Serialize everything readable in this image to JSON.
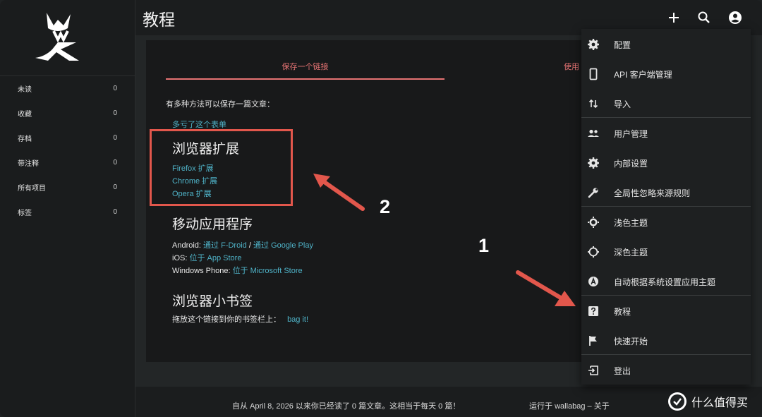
{
  "header": {
    "title": "教程",
    "icons": [
      "plus-icon",
      "search-icon",
      "account-icon"
    ]
  },
  "sidebar": {
    "items": [
      {
        "label": "未读",
        "count": "0"
      },
      {
        "label": "收藏",
        "count": "0"
      },
      {
        "label": "存档",
        "count": "0"
      },
      {
        "label": "带注释",
        "count": "0"
      },
      {
        "label": "所有项目",
        "count": "0"
      },
      {
        "label": "标签",
        "count": "0"
      }
    ]
  },
  "main": {
    "tabs": [
      {
        "label": "保存一个链接"
      },
      {
        "label": "使用"
      }
    ],
    "intro": "有多种方法可以保存一篇文章：",
    "form_link": "多亏了这个表单",
    "browser": {
      "heading": "浏览器扩展",
      "links": [
        "Firefox 扩展",
        "Chrome 扩展",
        "Opera 扩展"
      ]
    },
    "mobile": {
      "heading": "移动应用程序",
      "android_label": "Android:",
      "android_fdroid": "通过 F-Droid",
      "android_sep": "/",
      "android_gplay": "通过 Google Play",
      "ios_label": "iOS:",
      "ios_link": "位于 App Store",
      "wp_label": "Windows Phone:",
      "wp_link": "位于 Microsoft Store"
    },
    "bookmarklet": {
      "heading": "浏览器小书签",
      "text": "拖放这个链接到你的书签栏上：",
      "link": "bag it!"
    }
  },
  "menu": {
    "items": [
      {
        "label": "配置",
        "icon": "gear-icon"
      },
      {
        "label": "API 客户端管理",
        "icon": "phone-icon"
      },
      {
        "label": "导入",
        "icon": "import-arrows-icon"
      },
      {
        "label": "用户管理",
        "icon": "users-icon"
      },
      {
        "label": "内部设置",
        "icon": "gear-icon"
      },
      {
        "label": "全局性忽略来源规则",
        "icon": "wrench-icon"
      },
      {
        "label": "浅色主题",
        "icon": "brightness-light-icon"
      },
      {
        "label": "深色主题",
        "icon": "brightness-dark-icon"
      },
      {
        "label": "自动根据系统设置应用主题",
        "icon": "brightness-auto-icon"
      },
      {
        "label": "教程",
        "icon": "help-icon"
      },
      {
        "label": "快速开始",
        "icon": "flag-icon"
      },
      {
        "label": "登出",
        "icon": "logout-icon"
      }
    ]
  },
  "footer": {
    "stats": "自从 April 8, 2026 以来你已经读了 0 篇文章。这相当于每天 0 篇！",
    "powered_prefix": "运行于",
    "powered_app": "wallabag",
    "powered_sep": "–",
    "about": "关于"
  },
  "annotations": {
    "marker_1": "1",
    "marker_2": "2",
    "arrow_color": "#e2574c"
  },
  "watermark": {
    "text": "什么值得买"
  }
}
